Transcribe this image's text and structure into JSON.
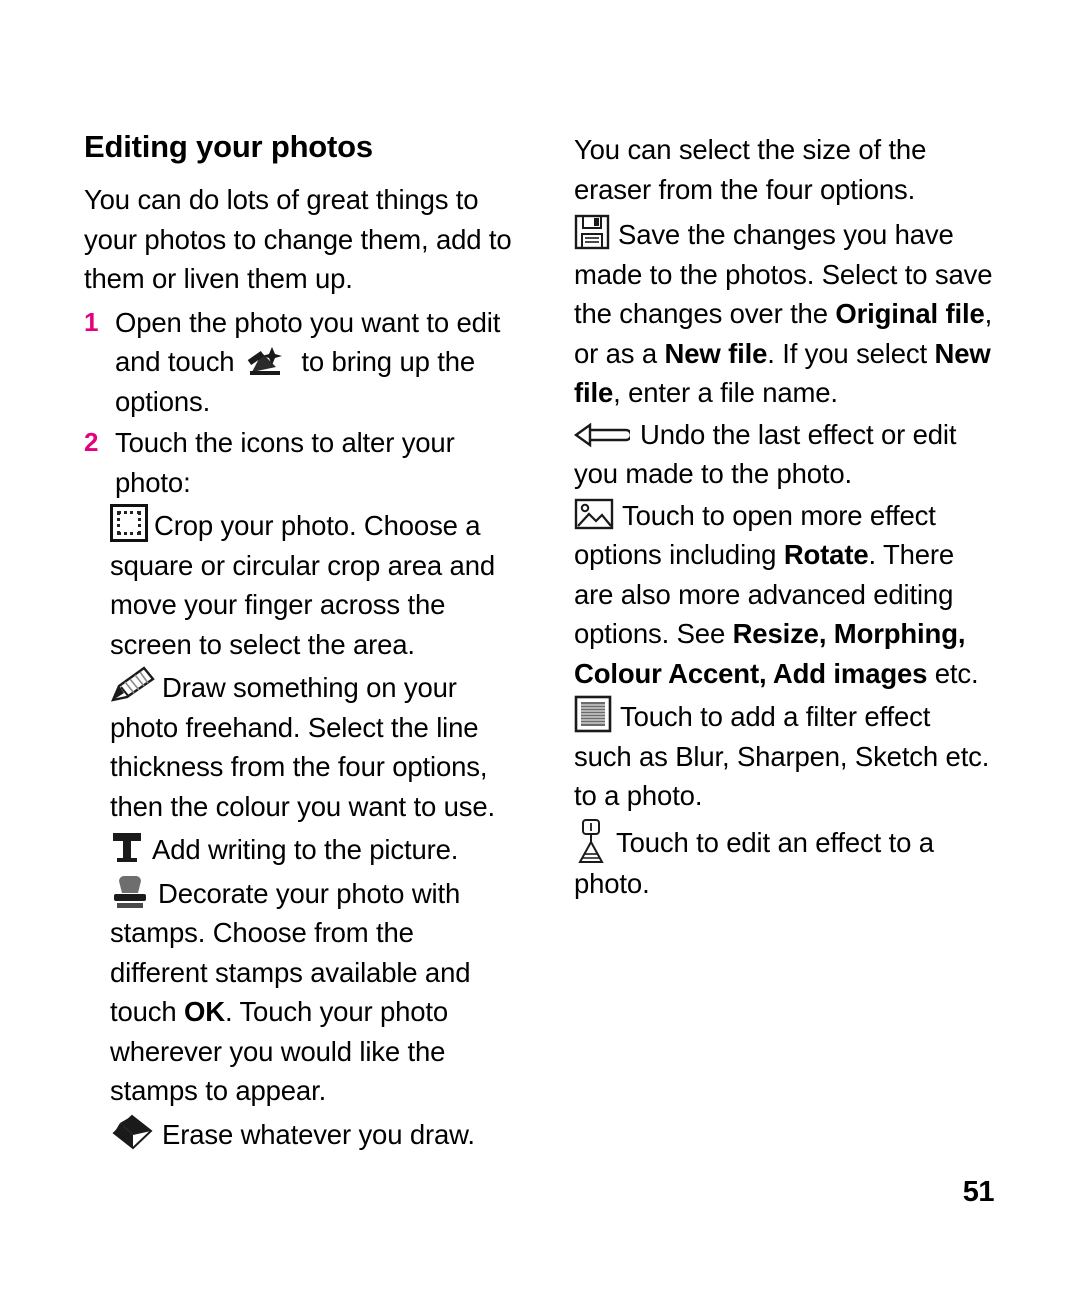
{
  "page": {
    "number": "51",
    "accent_color": "#e4007f"
  },
  "left_column": {
    "title": "Editing your photos",
    "intro": "You can do lots of great things to your photos to change them, add to them or liven them up.",
    "steps": [
      {
        "number": "1",
        "text_before_icon": "Open the photo you want to edit and touch ",
        "icon": "magic-wand-icon",
        "text_after_icon": " to bring up the options."
      },
      {
        "number": "2",
        "text_before_icon": "Touch the icons to alter your photo:",
        "icon": "",
        "text_after_icon": ""
      }
    ],
    "items": [
      {
        "icon": "crop-icon",
        "text": "Crop your photo. Choose a square or circular crop area and move your finger across the screen to select the area."
      },
      {
        "icon": "draw-pencil-icon",
        "text": "Draw something on your photo freehand. Select the line thickness from the four options, then the colour you want to use."
      },
      {
        "icon": "text-tool-icon",
        "text": "Add writing to the picture."
      },
      {
        "icon": "stamp-icon",
        "text_part1": "Decorate your photo with stamps. Choose from the different stamps available and touch ",
        "bold1": "OK",
        "text_part2": ". Touch your photo wherever you would like the stamps to appear."
      },
      {
        "icon": "eraser-icon",
        "text": "Erase whatever you draw."
      }
    ]
  },
  "right_column": {
    "intro": "You can select the size of the eraser from the four options.",
    "items": [
      {
        "icon": "save-floppy-icon",
        "text_part1": "Save the changes you have made to the photos. Select to save the changes over the ",
        "bold1": "Original file",
        "text_part2": ", or as a ",
        "bold2": "New file",
        "text_part3": ". If you select ",
        "bold3": "New file",
        "text_part4": ", enter a file name."
      },
      {
        "icon": "undo-arrow-icon",
        "text": "Undo the last effect or edit you made to the photo."
      },
      {
        "icon": "picture-effects-icon",
        "text_part1": "Touch to open more effect options including ",
        "bold1": "Rotate",
        "text_part2": ". There are also more advanced editing options. See ",
        "bold2": "Resize, Morphing, Colour Accent, Add images",
        "text_part3": " etc."
      },
      {
        "icon": "filter-icon",
        "text": "Touch to add a filter effect such as Blur, Sharpen, Sketch etc. to a photo."
      },
      {
        "icon": "edit-effect-icon",
        "text": "Touch to edit an effect to a photo."
      }
    ]
  }
}
